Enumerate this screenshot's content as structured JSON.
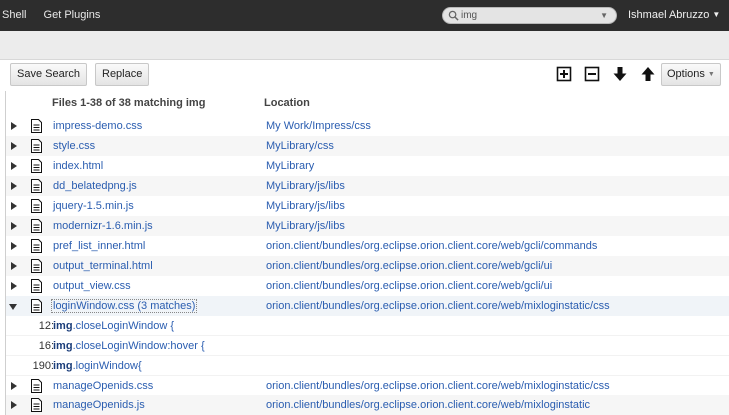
{
  "topbar": {
    "nav": [
      "Shell",
      "Get Plugins"
    ],
    "search_value": "img",
    "user": "Ishmael Abruzzo"
  },
  "toolbar": {
    "save_search": "Save Search",
    "replace": "Replace",
    "options": "Options"
  },
  "header": {
    "files": "Files 1-38 of 38 matching img",
    "location": "Location"
  },
  "results": [
    {
      "name": "impress-demo.css",
      "location": "My Work/Impress/css",
      "expanded": false
    },
    {
      "name": "style.css",
      "location": "MyLibrary/css",
      "expanded": false
    },
    {
      "name": "index.html",
      "location": "MyLibrary",
      "expanded": false
    },
    {
      "name": "dd_belatedpng.js",
      "location": "MyLibrary/js/libs",
      "expanded": false
    },
    {
      "name": "jquery-1.5.min.js",
      "location": "MyLibrary/js/libs",
      "expanded": false
    },
    {
      "name": "modernizr-1.6.min.js",
      "location": "MyLibrary/js/libs",
      "expanded": false
    },
    {
      "name": "pref_list_inner.html",
      "location": "orion.client/bundles/org.eclipse.orion.client.core/web/gcli/commands",
      "expanded": false
    },
    {
      "name": "output_terminal.html",
      "location": "orion.client/bundles/org.eclipse.orion.client.core/web/gcli/ui",
      "expanded": false
    },
    {
      "name": "output_view.css",
      "location": "orion.client/bundles/org.eclipse.orion.client.core/web/gcli/ui",
      "expanded": false
    },
    {
      "name": "loginWindow.css (3 matches)",
      "location": "orion.client/bundles/org.eclipse.orion.client.core/web/mixloginstatic/css",
      "expanded": true
    }
  ],
  "matches": [
    {
      "line": "12:",
      "term": "img",
      "rest": ".closeLoginWindow {"
    },
    {
      "line": "16:",
      "term": "img",
      "rest": ".closeLoginWindow:hover {"
    },
    {
      "line": "190:",
      "term": "img",
      "rest": ".loginWindow{"
    }
  ],
  "results_after": [
    {
      "name": "manageOpenids.css",
      "location": "orion.client/bundles/org.eclipse.orion.client.core/web/mixloginstatic/css",
      "expanded": false
    },
    {
      "name": "manageOpenids.js",
      "location": "orion.client/bundles/org.eclipse.orion.client.core/web/mixloginstatic",
      "expanded": false
    }
  ],
  "colors": {
    "topbar": "#2d2d2d",
    "link": "#2a5db0",
    "band": "#ececec"
  }
}
